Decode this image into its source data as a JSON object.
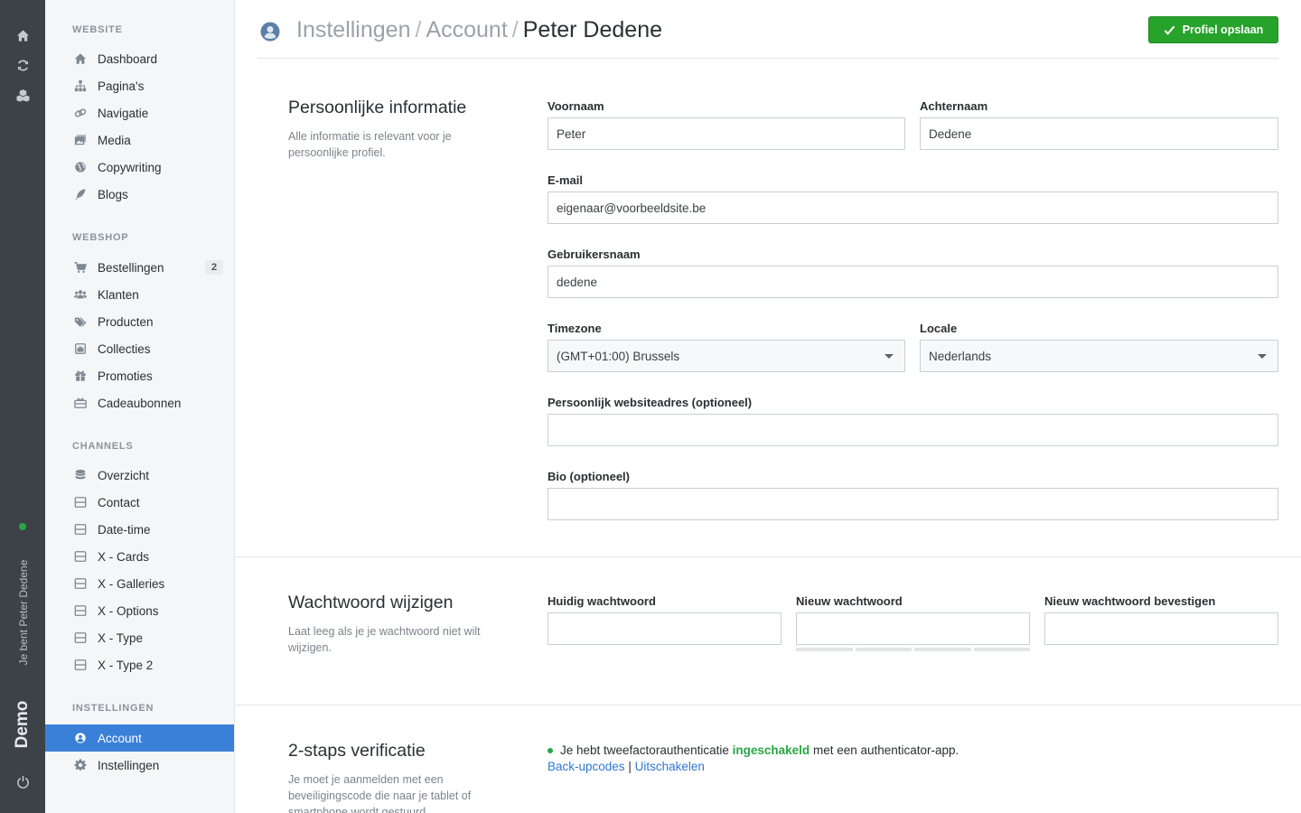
{
  "rail": {
    "user_text": "Je bent Peter Dedene",
    "brand": "Demo"
  },
  "sidebar": {
    "sections": [
      {
        "heading": "WEBSITE",
        "items": [
          {
            "label": "Dashboard",
            "icon": "home-icon"
          },
          {
            "label": "Pagina's",
            "icon": "sitemap-icon"
          },
          {
            "label": "Navigatie",
            "icon": "link-icon"
          },
          {
            "label": "Media",
            "icon": "images-icon"
          },
          {
            "label": "Copywriting",
            "icon": "globe-icon"
          },
          {
            "label": "Blogs",
            "icon": "feather-icon"
          }
        ]
      },
      {
        "heading": "WEBSHOP",
        "items": [
          {
            "label": "Bestellingen",
            "icon": "cart-icon",
            "badge": "2"
          },
          {
            "label": "Klanten",
            "icon": "users-icon"
          },
          {
            "label": "Producten",
            "icon": "tags-icon"
          },
          {
            "label": "Collecties",
            "icon": "collection-icon"
          },
          {
            "label": "Promoties",
            "icon": "gift-icon"
          },
          {
            "label": "Cadeaubonnen",
            "icon": "gift-card-icon"
          }
        ]
      },
      {
        "heading": "CHANNELS",
        "items": [
          {
            "label": "Overzicht",
            "icon": "database-icon"
          },
          {
            "label": "Contact",
            "icon": "channel-icon"
          },
          {
            "label": "Date-time",
            "icon": "channel-icon"
          },
          {
            "label": "X - Cards",
            "icon": "channel-icon"
          },
          {
            "label": "X - Galleries",
            "icon": "channel-icon"
          },
          {
            "label": "X - Options",
            "icon": "channel-icon"
          },
          {
            "label": "X - Type",
            "icon": "channel-icon"
          },
          {
            "label": "X - Type 2",
            "icon": "channel-icon"
          }
        ]
      },
      {
        "heading": "INSTELLINGEN",
        "items": [
          {
            "label": "Account",
            "icon": "user-circle-icon",
            "active": true
          },
          {
            "label": "Instellingen",
            "icon": "gear-icon"
          }
        ]
      }
    ]
  },
  "header": {
    "breadcrumb": [
      "Instellingen",
      "Account",
      "Peter Dedene"
    ],
    "separator": "/",
    "save_label": "Profiel opslaan"
  },
  "personal": {
    "title": "Persoonlijke informatie",
    "description": "Alle informatie is relevant voor je persoonlijke profiel.",
    "first_name": {
      "label": "Voornaam",
      "value": "Peter"
    },
    "last_name": {
      "label": "Achternaam",
      "value": "Dedene"
    },
    "email": {
      "label": "E-mail",
      "value": "eigenaar@voorbeeldsite.be"
    },
    "username": {
      "label": "Gebruikersnaam",
      "value": "dedene"
    },
    "timezone": {
      "label": "Timezone",
      "value": "(GMT+01:00) Brussels"
    },
    "locale": {
      "label": "Locale",
      "value": "Nederlands"
    },
    "website": {
      "label": "Persoonlijk websiteadres (optioneel)",
      "value": ""
    },
    "bio": {
      "label": "Bio (optioneel)",
      "value": ""
    }
  },
  "password": {
    "title": "Wachtwoord wijzigen",
    "description": "Laat leeg als je je wachtwoord niet wilt wijzigen.",
    "current": {
      "label": "Huidig wachtwoord",
      "value": ""
    },
    "new": {
      "label": "Nieuw wachtwoord",
      "value": ""
    },
    "confirm": {
      "label": "Nieuw wachtwoord bevestigen",
      "value": ""
    }
  },
  "two_factor": {
    "title": "2-staps verificatie",
    "description": "Je moet je aanmelden met een beveiligingscode die naar je tablet of smartphone wordt gestuurd.",
    "status_prefix": "Je hebt tweefactorauthenticatie",
    "status_word": "ingeschakeld",
    "status_suffix": "met een authenticator-app.",
    "backup_link": "Back-upcodes",
    "link_separator": "|",
    "disable_link": "Uitschakelen"
  },
  "colors": {
    "rail": "#3c4247",
    "sidebar": "#f5f6f7",
    "active": "#3b80d8",
    "save": "#27a22b",
    "link": "#2f78d0",
    "success": "#28a745"
  }
}
